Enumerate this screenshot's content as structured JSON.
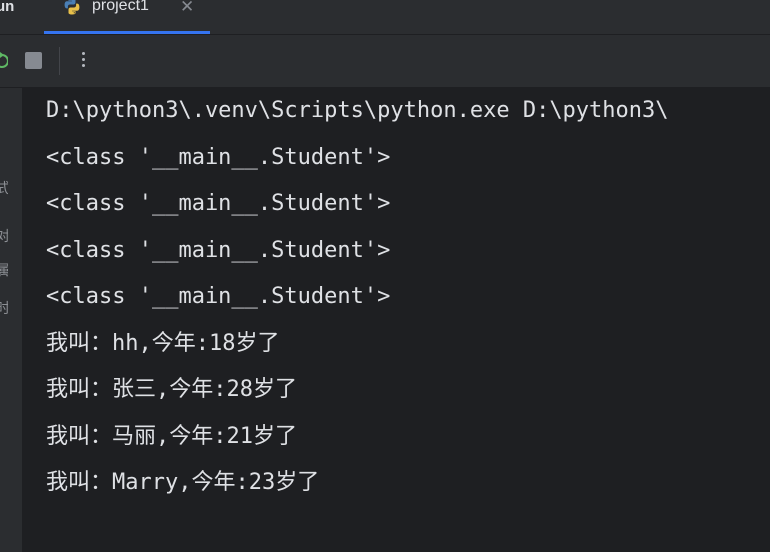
{
  "tool_window": {
    "title": "un"
  },
  "tabs": [
    {
      "label": "project1",
      "icon": "python-icon",
      "active": true
    }
  ],
  "toolbar": {
    "rerun_icon": "rerun-icon",
    "stop_icon": "stop-icon",
    "more_icon": "more-options-icon"
  },
  "gutter": {
    "glyphs": [
      "式",
      "对",
      "属",
      "时"
    ]
  },
  "console": {
    "lines": [
      "D:\\python3\\.venv\\Scripts\\python.exe D:\\python3\\",
      "<class '__main__.Student'>",
      "<class '__main__.Student'>",
      "<class '__main__.Student'>",
      "<class '__main__.Student'>",
      "我叫：hh,今年:18岁了",
      "我叫：张三,今年:28岁了",
      "我叫：马丽,今年:21岁了",
      "我叫：Marry,今年:23岁了"
    ]
  },
  "colors": {
    "background": "#1e1f22",
    "panel": "#2b2d30",
    "text": "#dfe1e5",
    "accent": "#3574f0"
  }
}
